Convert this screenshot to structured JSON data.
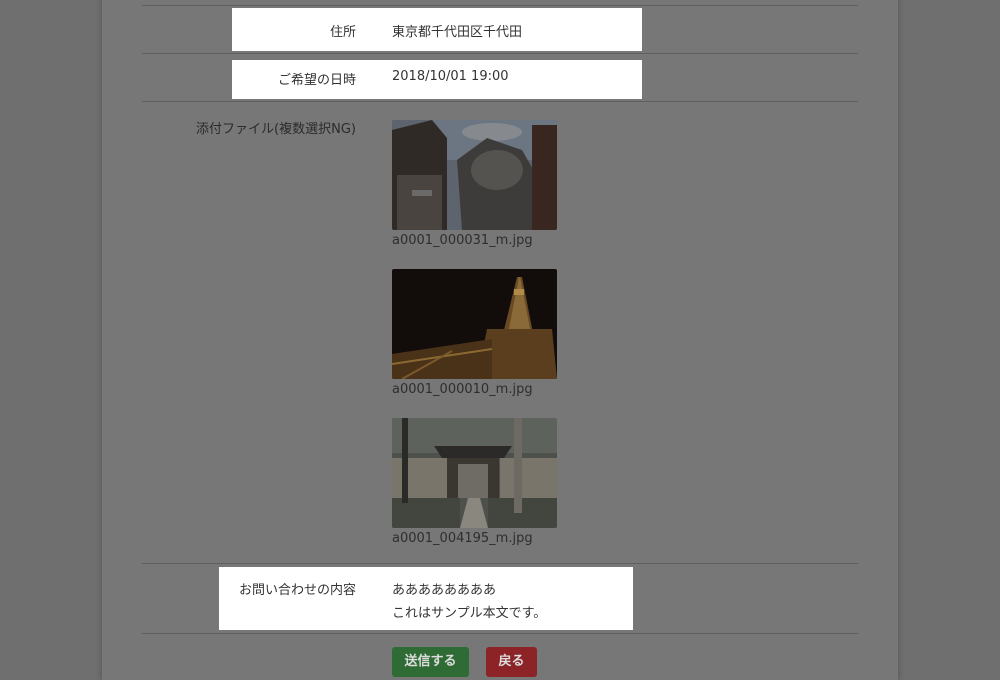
{
  "rows": {
    "address": {
      "label": "住所",
      "value": "東京都千代田区千代田"
    },
    "datetime": {
      "label": "ご希望の日時",
      "value": "2018/10/01 19:00"
    },
    "attachments": {
      "label": "添付ファイル(複数選択NG)"
    },
    "inquiry": {
      "label": "お問い合わせの内容",
      "lines": [
        "ああああああああ",
        "これはサンプル本文です。"
      ]
    }
  },
  "files": [
    {
      "name": "a0001_000031_m.jpg",
      "icon": "shrine-lion-statue-photo"
    },
    {
      "name": "a0001_000010_m.jpg",
      "icon": "tokyo-tower-night-photo"
    },
    {
      "name": "a0001_004195_m.jpg",
      "icon": "temple-gate-photo"
    }
  ],
  "buttons": {
    "submit": "送信する",
    "back": "戻る"
  },
  "colors": {
    "submit": "#2f8a3c",
    "back": "#b3282c",
    "highlight": "#ffffff",
    "overlay": "#777777"
  }
}
